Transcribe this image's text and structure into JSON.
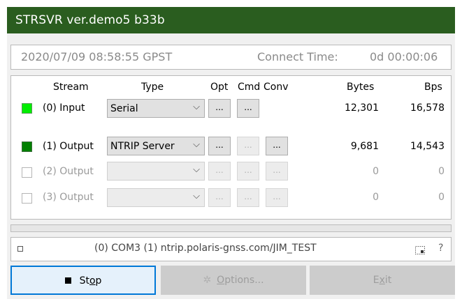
{
  "window": {
    "title": "STRSVR ver.demo5 b33b"
  },
  "status": {
    "clock": "2020/07/09 08:58:55 GPST",
    "connect_label": "Connect Time:",
    "connect_value": "0d 00:00:06"
  },
  "columns": {
    "stream": "Stream",
    "type": "Type",
    "opt": "Opt",
    "cmd": "Cmd",
    "conv": "Conv",
    "bytes": "Bytes",
    "bps": "Bps"
  },
  "streams": [
    {
      "label": "(0) Input",
      "type": "Serial",
      "bytes": "12,301",
      "bps": "16,578",
      "opt": "...",
      "cmd": "...",
      "led_color": "#00ee00"
    },
    {
      "label": "(1) Output",
      "type": "NTRIP Server",
      "bytes": "9,681",
      "bps": "14,543",
      "opt": "...",
      "cmd": "...",
      "conv": "...",
      "led_color": "#008000"
    },
    {
      "label": "(2) Output",
      "type": "",
      "bytes": "0",
      "bps": "0",
      "opt": "...",
      "cmd": "...",
      "conv": "..."
    },
    {
      "label": "(3) Output",
      "type": "",
      "bytes": "0",
      "bps": "0",
      "opt": "...",
      "cmd": "...",
      "conv": "..."
    }
  ],
  "info": {
    "text": "(0) COM3 (1) ntrip.polaris-gnss.com/JIM_TEST",
    "help": "?"
  },
  "buttons": {
    "stop_pre": "St",
    "stop_ul": "o",
    "stop_post": "p",
    "options_ul": "O",
    "options_post": "ptions...",
    "exit_pre": "E",
    "exit_ul": "x",
    "exit_post": "it"
  },
  "icons": {
    "stop": "stop-square-icon",
    "options": "gear-icon",
    "dropdown": "chevron-down-icon",
    "resize": "grip-icon"
  }
}
